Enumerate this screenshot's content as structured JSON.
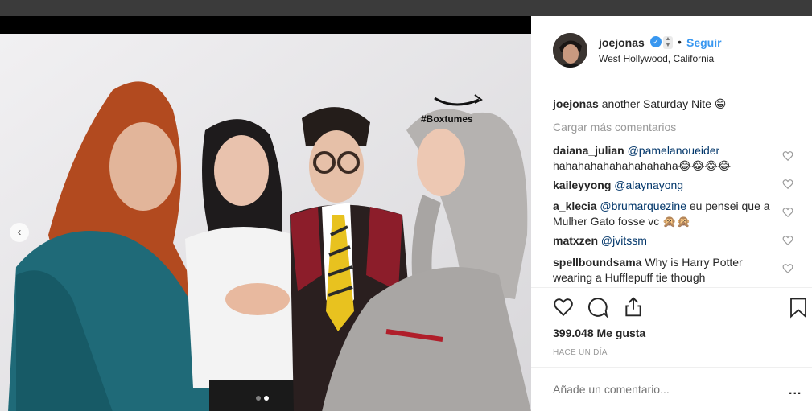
{
  "post": {
    "username": "joejonas",
    "verified_badge": "verified-icon",
    "follow_separator": "•",
    "follow_label": "Seguir",
    "location": "West Hollywood, California",
    "caption_user": "joejonas",
    "caption_text": "another Saturday Nite 😁",
    "load_more": "Cargar más comentarios",
    "photo_watermark": "#Boxtumes"
  },
  "comments": [
    {
      "user": "daiana_julian",
      "text": "@pamelanoueider hahahahahahahahahaha😂😂😂😂"
    },
    {
      "user": "kaileyyong",
      "text": "@alaynayong"
    },
    {
      "user": "a_klecia",
      "text": "@brumarquezine eu pensei que a Mulher Gato fosse vc 🙊🙊"
    },
    {
      "user": "matxzen",
      "text": "@jvitssm"
    },
    {
      "user": "spellboundsama",
      "text": "Why is Harry Potter wearing a Hufflepuff tie though"
    }
  ],
  "footer": {
    "likes": "399.048 Me gusta",
    "time": "HACE UN DÍA",
    "add_comment_placeholder": "Añade un comentario...",
    "more": "..."
  },
  "icons": {
    "like": "heart-icon",
    "comment": "comment-bubble-icon",
    "share": "share-icon",
    "save": "bookmark-icon",
    "prev": "chevron-left-icon"
  },
  "colors": {
    "accent": "#3897f0",
    "text": "#262626",
    "muted": "#999999",
    "border": "#efefef"
  },
  "carousel": {
    "current": 2,
    "total": 2
  }
}
